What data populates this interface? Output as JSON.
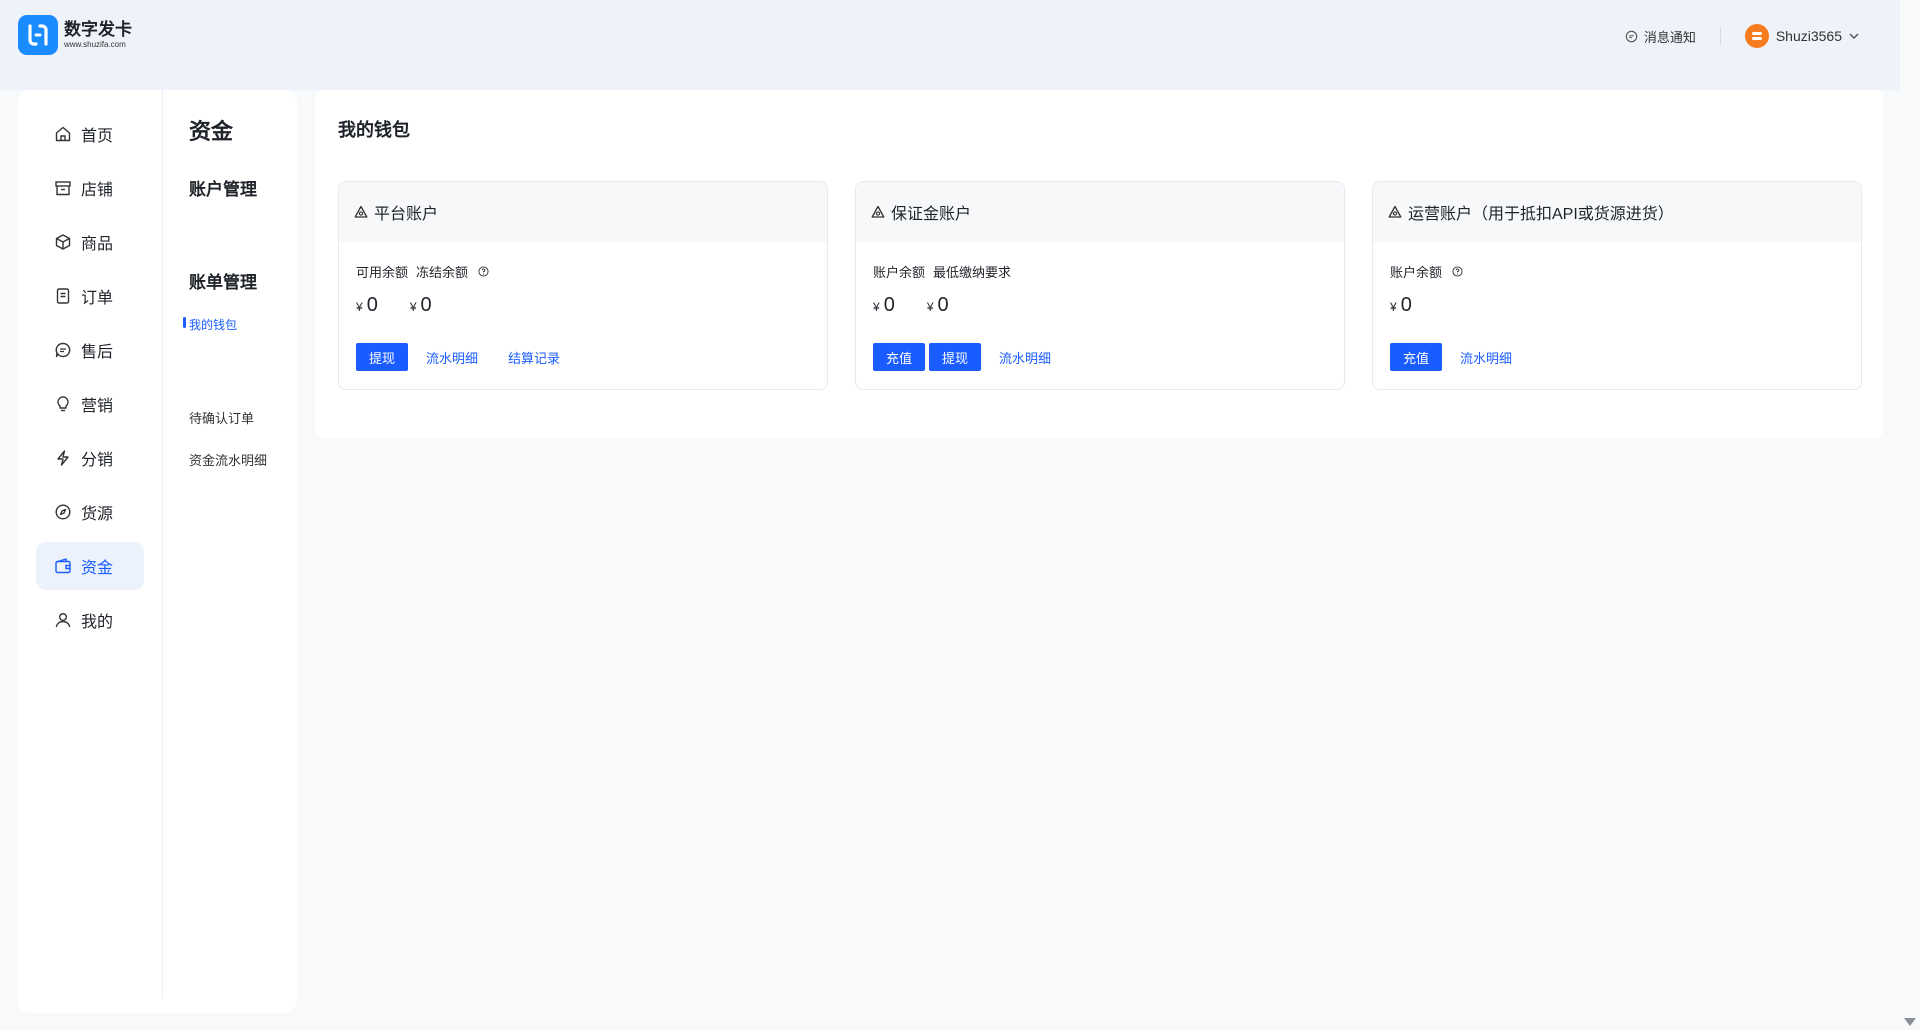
{
  "header": {
    "logo_title": "数字发卡",
    "logo_url": "www.shuzifa.com",
    "notice_label": "消息通知",
    "username": "Shuzi3565"
  },
  "nav": [
    {
      "label": "首页",
      "icon": "home-icon"
    },
    {
      "label": "店铺",
      "icon": "store-icon"
    },
    {
      "label": "商品",
      "icon": "box-icon"
    },
    {
      "label": "订单",
      "icon": "order-icon"
    },
    {
      "label": "售后",
      "icon": "chat-icon"
    },
    {
      "label": "营销",
      "icon": "bulb-icon"
    },
    {
      "label": "分销",
      "icon": "lightning-icon"
    },
    {
      "label": "货源",
      "icon": "compass-icon"
    },
    {
      "label": "资金",
      "icon": "wallet-icon",
      "active": true
    },
    {
      "label": "我的",
      "icon": "user-icon"
    }
  ],
  "subnav": {
    "title": "资金",
    "group1": "账户管理",
    "my_wallet": "我的钱包",
    "group2": "账单管理",
    "pending_orders": "待确认订单",
    "fund_flow": "资金流水明细"
  },
  "main": {
    "page_title": "我的钱包",
    "cards": [
      {
        "title": "平台账户",
        "labels": [
          "可用余额",
          "冻结余额"
        ],
        "amounts": [
          "0",
          "0"
        ],
        "buttons": [
          "提现"
        ],
        "links": [
          "流水明细",
          "结算记录"
        ]
      },
      {
        "title": "保证金账户",
        "labels": [
          "账户余额",
          "最低缴纳要求"
        ],
        "amounts": [
          "0",
          "0"
        ],
        "buttons": [
          "充值",
          "提现"
        ],
        "links": [
          "流水明细"
        ]
      },
      {
        "title": "运营账户（用于抵扣API或货源进货）",
        "labels": [
          "账户余额"
        ],
        "amounts": [
          "0"
        ],
        "buttons": [
          "充值"
        ],
        "links": [
          "流水明细"
        ]
      }
    ],
    "currency_symbol": "¥"
  },
  "colors": {
    "accent": "#1a5cff",
    "logo": "#1a8cff",
    "avatar": "#f77b1f",
    "header_bg": "#eef2f9"
  }
}
